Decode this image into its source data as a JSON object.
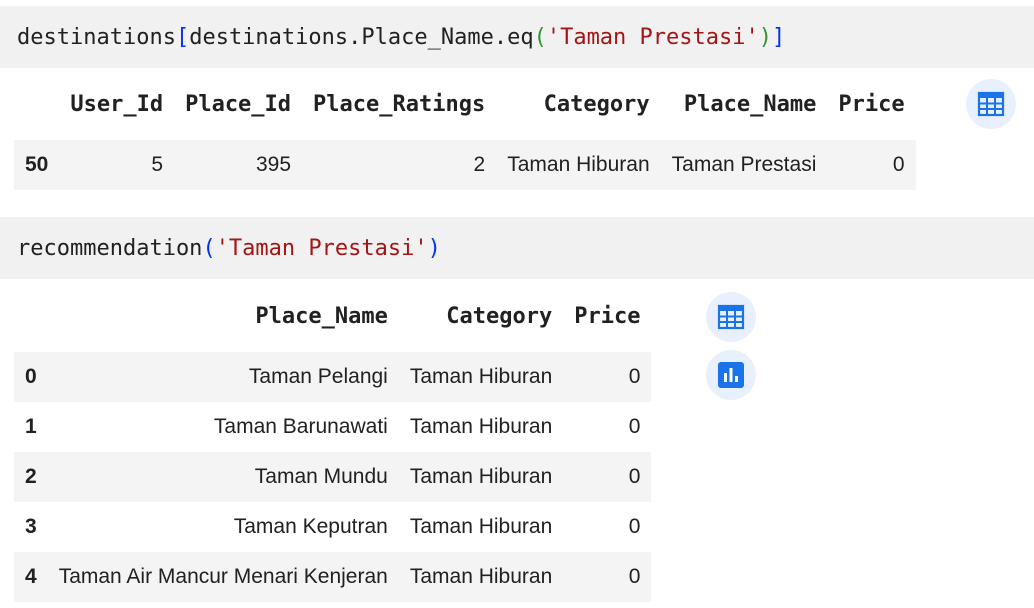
{
  "cell1": {
    "code_obj": "destinations",
    "code_open_br": "[",
    "code_mid": "destinations.Place_Name.eq",
    "code_open_paren": "(",
    "code_str": "'Taman Prestasi'",
    "code_close_paren": ")",
    "code_close_br": "]"
  },
  "output1": {
    "headers": [
      "",
      "User_Id",
      "Place_Id",
      "Place_Ratings",
      "Category",
      "Place_Name",
      "Price"
    ],
    "rows": [
      [
        "50",
        "5",
        "395",
        "2",
        "Taman Hiburan",
        "Taman Prestasi",
        "0"
      ]
    ],
    "table_icon": "table-view-icon"
  },
  "cell2": {
    "code_fn": "recommendation",
    "code_open_paren": "(",
    "code_str": "'Taman Prestasi'",
    "code_close_paren": ")"
  },
  "output2": {
    "headers": [
      "",
      "Place_Name",
      "Category",
      "Price"
    ],
    "rows": [
      [
        "0",
        "Taman Pelangi",
        "Taman Hiburan",
        "0"
      ],
      [
        "1",
        "Taman Barunawati",
        "Taman Hiburan",
        "0"
      ],
      [
        "2",
        "Taman Mundu",
        "Taman Hiburan",
        "0"
      ],
      [
        "3",
        "Taman Keputran",
        "Taman Hiburan",
        "0"
      ],
      [
        "4",
        "Taman Air Mancur Menari Kenjeran",
        "Taman Hiburan",
        "0"
      ]
    ],
    "table_icon": "table-view-icon",
    "chart_icon": "bar-chart-icon"
  },
  "colors": {
    "cell_bg": "#f1f1f1",
    "string": "#a31515",
    "bracket": "#0431fa",
    "paren": "#319331",
    "icon_bg": "#e8f0fe",
    "icon_fg": "#1a73e8"
  }
}
